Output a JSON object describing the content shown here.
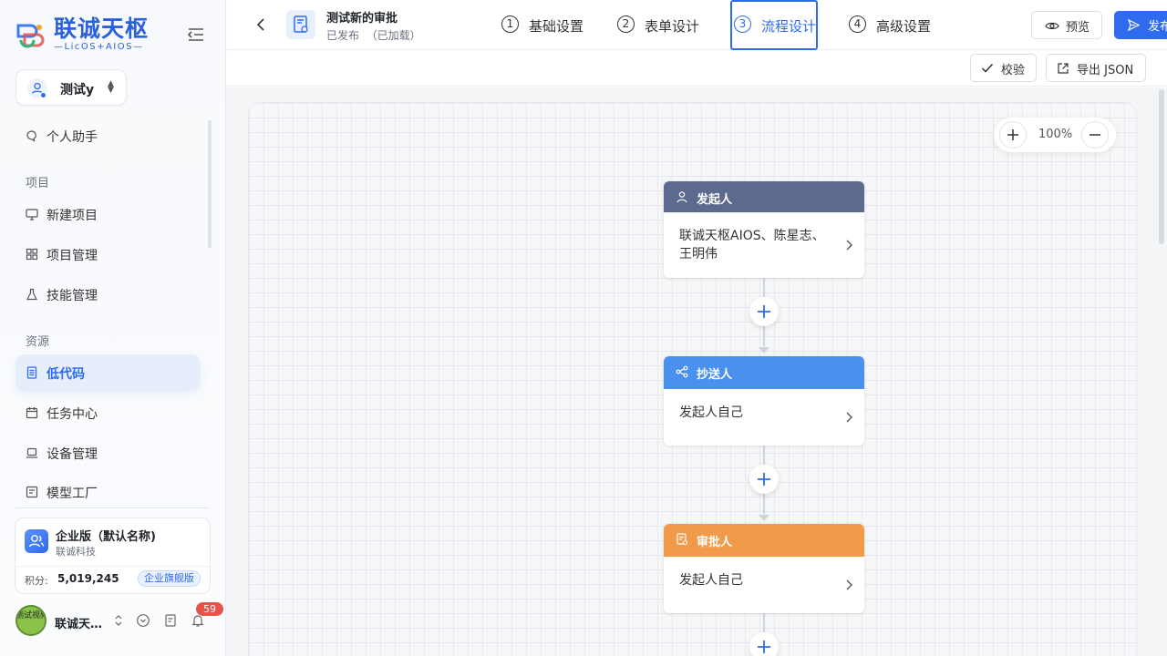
{
  "brand": {
    "name": "联诚天枢",
    "sub": "—LicOS+AIOS—"
  },
  "workspace": {
    "name": "测试y"
  },
  "nav": {
    "items": [
      {
        "label": "个人助手"
      },
      {
        "label": "新建项目"
      },
      {
        "label": "项目管理"
      },
      {
        "label": "技能管理"
      },
      {
        "label": "低代码"
      },
      {
        "label": "任务中心"
      },
      {
        "label": "设备管理"
      },
      {
        "label": "模型工厂"
      }
    ],
    "sections": [
      "项目",
      "资源"
    ]
  },
  "enterprise": {
    "title": "企业版（默认名称)",
    "company": "联诚科技",
    "points_label": "积分:",
    "points": "5,019,245",
    "plan": "企业旗舰版"
  },
  "user": {
    "name": "联诚天枢AIOS",
    "avatar_text": "测试视频",
    "notifications": "59"
  },
  "header": {
    "title": "测试新的审批",
    "status": "已发布  （已加载）"
  },
  "steps": [
    {
      "num": "1",
      "label": "基础设置"
    },
    {
      "num": "2",
      "label": "表单设计"
    },
    {
      "num": "3",
      "label": "流程设计"
    },
    {
      "num": "4",
      "label": "高级设置"
    }
  ],
  "actions": {
    "preview": "预览",
    "publish": "发布",
    "validate": "校验",
    "export": "导出 JSON"
  },
  "zoom": {
    "level": "100%"
  },
  "flow": {
    "nodes": [
      {
        "type": "发起人",
        "content": "联诚天枢AIOS、陈星志、王明伟",
        "color": "#5d6a8f"
      },
      {
        "type": "抄送人",
        "content": "发起人自己",
        "color": "#4a90ef"
      },
      {
        "type": "审批人",
        "content": "发起人自己",
        "color": "#f09a4a"
      }
    ]
  },
  "colors": {
    "accent": "#2f6bef"
  }
}
